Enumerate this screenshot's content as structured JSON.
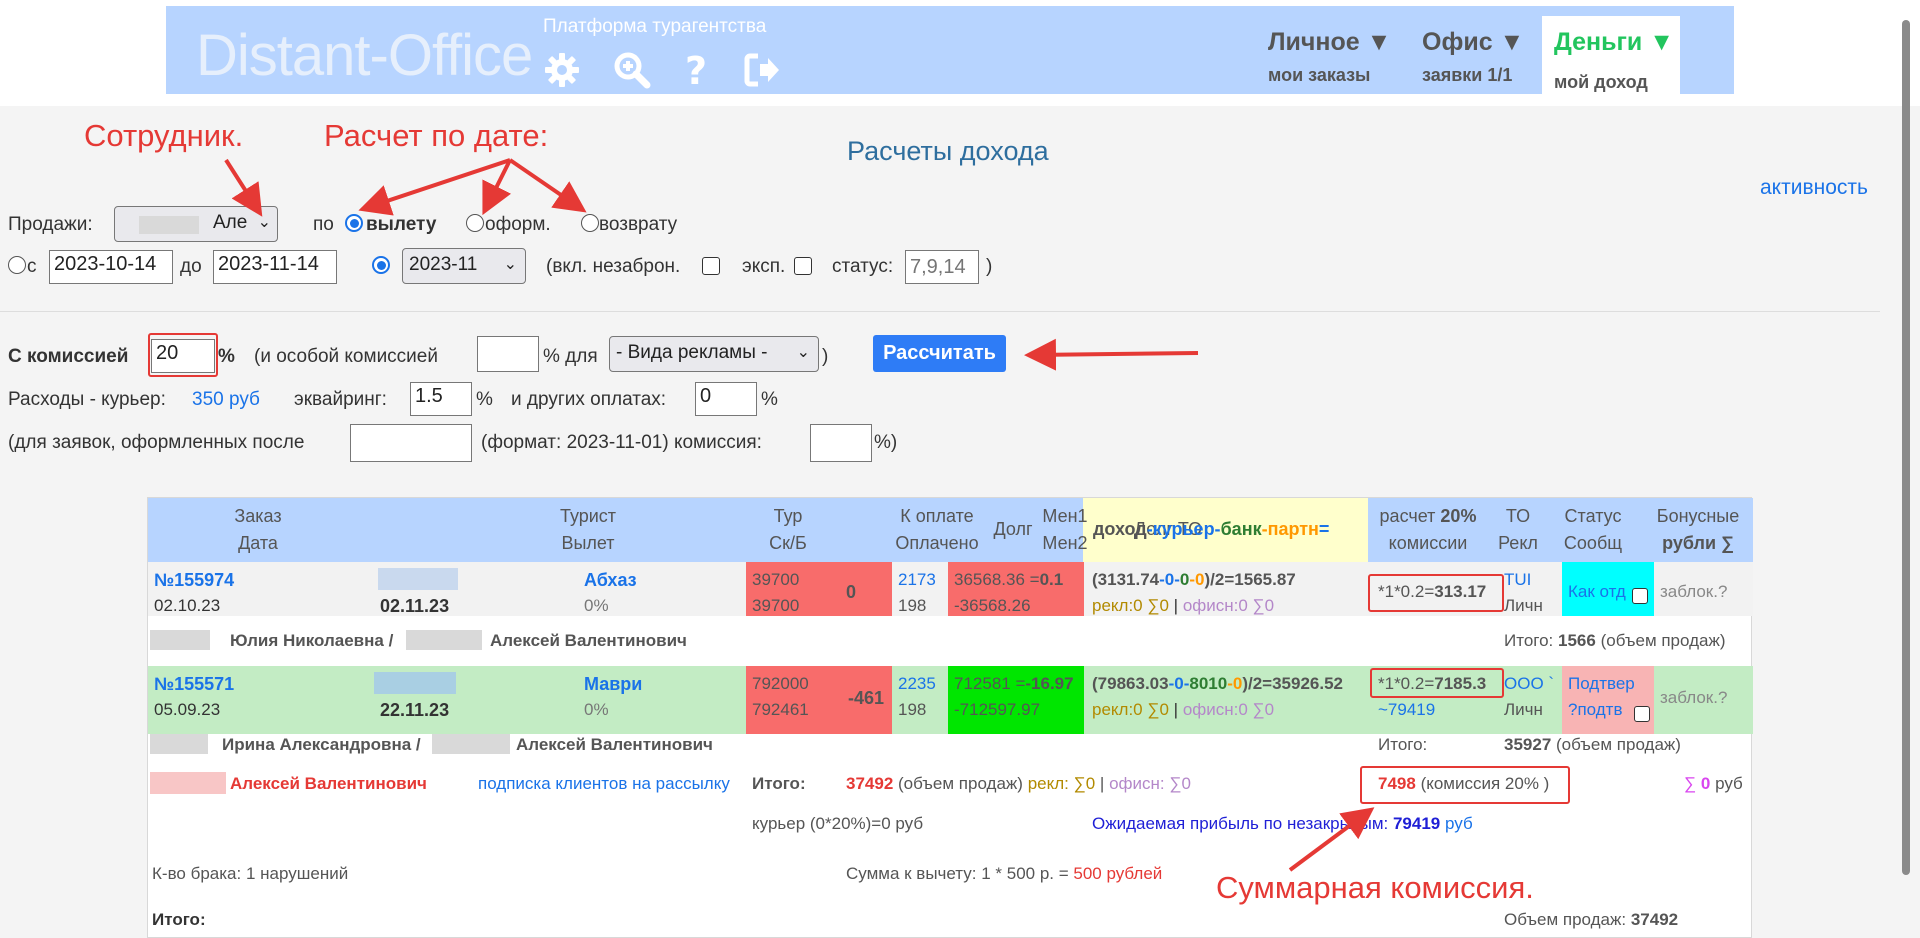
{
  "header": {
    "logo": "Distant-Office",
    "platform": "Платформа турагентства",
    "icons": [
      "gear-icon",
      "search-plus-icon",
      "help-icon",
      "logout-icon"
    ],
    "tabs": [
      {
        "title": "Личное ▼",
        "sub": "мои заказы"
      },
      {
        "title": "Офис ▼",
        "sub": "заявки 1/1"
      },
      {
        "title": "Деньги ▼",
        "sub": "мой доход"
      }
    ]
  },
  "page": {
    "title": "Расчеты дохода",
    "activity_link": "активность"
  },
  "form": {
    "sales_label": "Продажи:",
    "employee_value": "Але",
    "by_label": "по",
    "radio_flight": "вылету",
    "radio_issue": "оформ.",
    "radio_return": "возврату",
    "from_label": "с",
    "date_from": "2023-10-14",
    "to_label": "до",
    "date_to": "2023-11-14",
    "month_value": "2023-11",
    "incl_label": "(вкл. незаброн.",
    "exp_label": "эксп.",
    "status_label": "статус:",
    "status_placeholder": "7,9,14",
    "close_paren": ")",
    "commission_label": "С комиссией",
    "commission_value": "20",
    "percent": "%",
    "special_label": "(и особой комиссией",
    "for_label": "% для",
    "ad_select": "- Вида рекламы -",
    "close_paren2": ")",
    "calc_button": "Рассчитать",
    "expenses_label": "Расходы - курьер:",
    "courier_value": "350 руб",
    "acquiring_label": "эквайринг:",
    "acquiring_value": "1.5",
    "other_label": "и других оплатах:",
    "other_value": "0",
    "after_label": "(для заявок, оформленных после",
    "format_label": "(формат: 2023-11-01) комиссия:",
    "after_close": "%)"
  },
  "annotations": {
    "employee": "Сотрудник.",
    "date_calc": "Расчет по дате:",
    "total_commission": "Суммарная комиссия."
  },
  "table": {
    "headers": {
      "order": [
        "Заказ",
        "Дата"
      ],
      "tourist": [
        "Турист",
        "Вылет"
      ],
      "tour": [
        "Тур",
        "Ск/Б"
      ],
      "pay": [
        "К оплате",
        "Оплачено"
      ],
      "debt": "Долг",
      "mgr": [
        "Мен1",
        "Мен2"
      ],
      "debt_to": "Долг ТО",
      "income": {
        "a": "доход",
        "b": "-курьер-",
        "c": "банк",
        "d": "-партн",
        "e": "="
      },
      "calc": {
        "a": "расчет",
        "b": "20%",
        "c": "комиссии"
      },
      "to": [
        "ТО",
        "Рекл"
      ],
      "status": [
        "Статус",
        "Сообщ"
      ],
      "bonus": [
        "Бонусные",
        "рубли ∑"
      ]
    },
    "rows": [
      {
        "order": "№155974",
        "date": "02.10.23",
        "flight": "02.11.23",
        "tour": "Абхаз",
        "discount": "0%",
        "to_pay": "39700",
        "paid": "39700",
        "debt": "0",
        "mgr1": "2173",
        "mgr2": "198",
        "debt_to_1a": "36568.36 =",
        "debt_to_1b": "0.1",
        "debt_to_2": "-36568.26",
        "inc_open": "(",
        "inc_a": "3131.74",
        "inc_b": "-0-",
        "inc_c": "0",
        "inc_d": "-0",
        "inc_e": ")/2=",
        "inc_total": "1565.87",
        "rekl": "рекл:0 ∑0",
        "sep": "|",
        "ofis": "офисн:0 ∑0",
        "calc_pre": "*1*0.2=",
        "calc_val": "313.17",
        "to": "TUI",
        "rekl2": "Личн",
        "status": "Как отд",
        "bonus": "заблок.?",
        "client": "Юлия Николаевна /",
        "client2": "Алексей Валентинович",
        "itogo_label": "Итого:",
        "itogo_val": "1566",
        "itogo_suffix": "(объем продаж)"
      },
      {
        "order": "№155571",
        "date": "05.09.23",
        "flight": "22.11.23",
        "tour": "Маври",
        "discount": "0%",
        "to_pay": "792000",
        "paid": "792461",
        "debt": "-461",
        "mgr1": "2235",
        "mgr2": "198",
        "debt_to_1a": "712581 =",
        "debt_to_1b": "-16.97",
        "debt_to_2": "-712597.97",
        "inc_open": "(",
        "inc_a": "79863.03",
        "inc_b": "-0-",
        "inc_c": "8010",
        "inc_d": "-0",
        "inc_e": ")/2=",
        "inc_total": "35926.52",
        "rekl": "рекл:0 ∑0",
        "sep": "|",
        "ofis": "офисн:0 ∑0",
        "calc_pre": "*1*0.2=",
        "calc_val": "7185.3",
        "calc_extra": "~79419",
        "to": "ООО `",
        "rekl2": "Личн",
        "status": "Подтвер",
        "status2": "?подтв",
        "bonus": "заблок.?",
        "client": "Ирина Александровна /",
        "client2": "Алексей Валентинович",
        "itogo_label": "Итого:",
        "itogo_val": "35927",
        "itogo_suffix": "(объем продаж)"
      }
    ],
    "summary": {
      "employee": "Алексей Валентинович",
      "subscribe_link": "подписка клиентов на рассылку",
      "itogo_label": "Итого:",
      "itogo_val": "37492",
      "itogo_suffix": "(объем продаж)",
      "rekl": "рекл: ∑0",
      "sep": "|",
      "ofis": "офисн: ∑0",
      "commission_val": "7498",
      "commission_suffix": "(комиссия 20% )",
      "bonus_sum_sym": "∑",
      "bonus_sum_val": "0",
      "bonus_sum_unit": "руб",
      "courier": "курьер (0*20%)=0 руб",
      "expected_label": "Ожидаемая прибыль по незакрытым:",
      "expected_val": "79419",
      "expected_unit": "руб",
      "defects": "К-во брака: 1 нарушений",
      "deduct_label": "Сумма к вычету: 1 * 500 р. =",
      "deduct_val": "500 рублей",
      "final_label": "Итого:",
      "volume_label": "Объем продаж:",
      "volume_val": "37492"
    }
  },
  "colors": {
    "header_bg": "#b7d4ff",
    "money_tab": "#22c55e",
    "link": "#1a73e8",
    "debt_red": "#f86c6b",
    "debt_to_green": "#00e600",
    "status_cyan": "#00ffff",
    "status_pink": "#f8b4b4",
    "row2_green": "#c3ecc4",
    "income_header": "#ffffcc",
    "table_header": "#b7d4ff",
    "annotation": "#e53935",
    "button": "#2e7cf6"
  }
}
